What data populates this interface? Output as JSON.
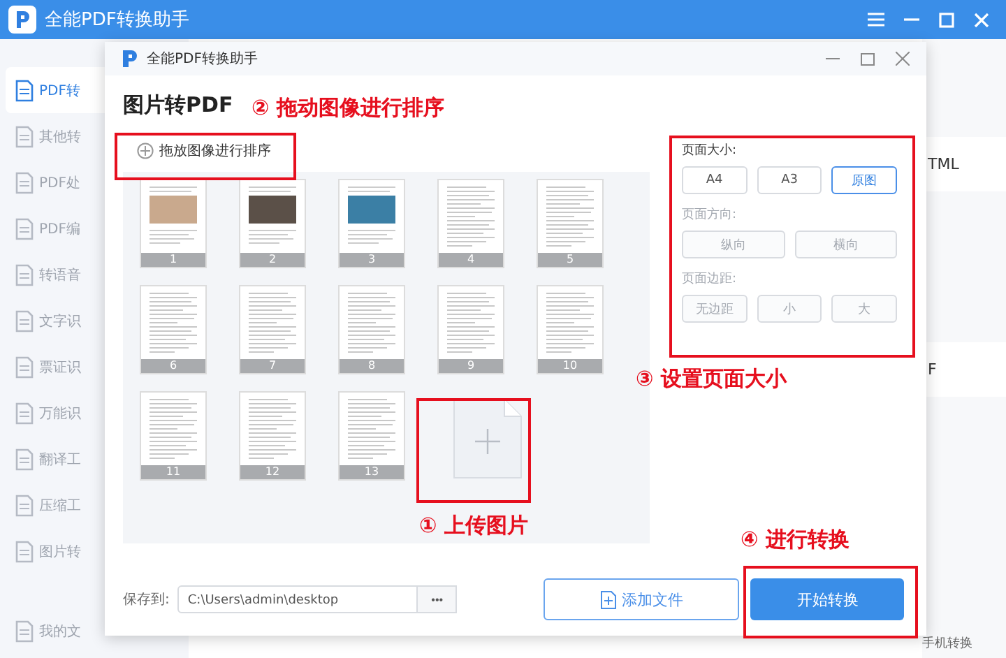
{
  "app": {
    "title": "全能PDF转换助手"
  },
  "sidebar": {
    "items": [
      {
        "label": "PDF转",
        "selected": true
      },
      {
        "label": "其他转",
        "selected": false
      },
      {
        "label": "PDF处",
        "selected": false
      },
      {
        "label": "PDF编",
        "selected": false
      },
      {
        "label": "转语音",
        "selected": false
      },
      {
        "label": "文字识",
        "selected": false
      },
      {
        "label": "票证识",
        "selected": false
      },
      {
        "label": "万能识",
        "selected": false
      },
      {
        "label": "翻译工",
        "selected": false
      },
      {
        "label": "压缩工",
        "selected": false
      },
      {
        "label": "图片转",
        "selected": false
      },
      {
        "label": "我的文",
        "selected": false
      }
    ]
  },
  "background_cards": [
    "TML",
    "F"
  ],
  "background_footer": "手机转换",
  "dialog": {
    "title": "全能PDF转换助手",
    "heading": "图片转PDF",
    "sort_hint": "拖放图像进行排序",
    "thumbnails": [
      {
        "number": "1",
        "kind": "photo"
      },
      {
        "number": "2",
        "kind": "photo"
      },
      {
        "number": "3",
        "kind": "photo"
      },
      {
        "number": "4",
        "kind": "text"
      },
      {
        "number": "5",
        "kind": "text"
      },
      {
        "number": "6",
        "kind": "text"
      },
      {
        "number": "7",
        "kind": "text"
      },
      {
        "number": "8",
        "kind": "text"
      },
      {
        "number": "9",
        "kind": "text"
      },
      {
        "number": "10",
        "kind": "text"
      },
      {
        "number": "11",
        "kind": "text"
      },
      {
        "number": "12",
        "kind": "text"
      },
      {
        "number": "13",
        "kind": "text"
      }
    ],
    "settings": [
      {
        "label": "页面大小:",
        "disabled": false,
        "options": [
          {
            "label": "A4",
            "selected": false
          },
          {
            "label": "A3",
            "selected": false
          },
          {
            "label": "原图",
            "selected": true
          }
        ]
      },
      {
        "label": "页面方向:",
        "disabled": true,
        "options": [
          {
            "label": "纵向",
            "selected": false
          },
          {
            "label": "横向",
            "selected": false
          }
        ]
      },
      {
        "label": "页面边距:",
        "disabled": true,
        "options": [
          {
            "label": "无边距",
            "selected": false
          },
          {
            "label": "小",
            "selected": false
          },
          {
            "label": "大",
            "selected": false
          }
        ]
      }
    ],
    "save_label": "保存到:",
    "save_path": "C:\\Users\\admin\\desktop",
    "browse": "•••",
    "add_file": "添加文件",
    "start": "开始转换"
  },
  "annotations": [
    {
      "text": "② 拖动图像进行排序",
      "kind": "sort"
    },
    {
      "text": "③ 设置页面大小",
      "kind": "settings"
    },
    {
      "text": "① 上传图片",
      "kind": "upload"
    },
    {
      "text": "④ 进行转换",
      "kind": "convert"
    }
  ]
}
